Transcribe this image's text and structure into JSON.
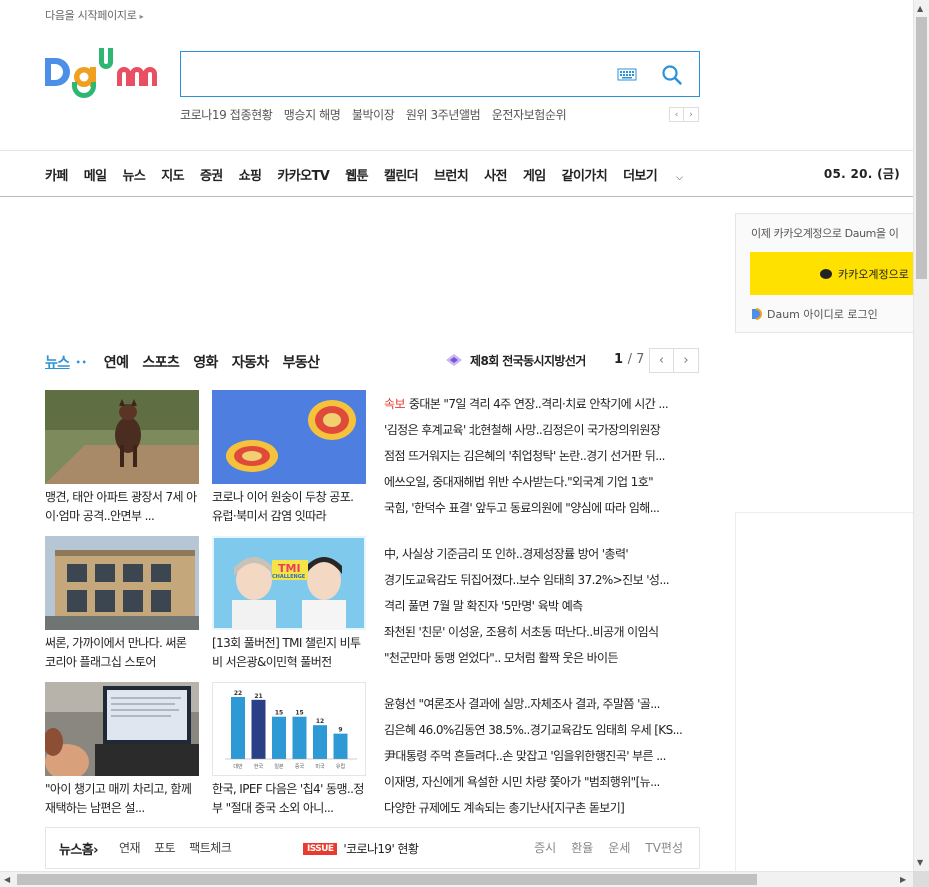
{
  "top_link": {
    "label": "다음을 시작페이지로",
    "arrow": "▸"
  },
  "logo": {
    "text": "Daum",
    "colors": [
      "#4b8fe9",
      "#f0a020",
      "#2eb673",
      "#e84f63"
    ]
  },
  "search": {
    "value": "",
    "keyboard_icon": "keyboard-icon",
    "search_icon": "search-icon",
    "accent": "#2b91d9"
  },
  "trends": {
    "items": [
      "코로나19 접종현황",
      "맹승지 해명",
      "불박이장",
      "원위 3주년앨범",
      "운전자보험순위"
    ],
    "prev": "‹",
    "next": "›"
  },
  "gnb": {
    "items": [
      "카페",
      "메일",
      "뉴스",
      "지도",
      "증권",
      "쇼핑",
      "카카오TV",
      "웹툰",
      "캘린더",
      "브런치",
      "사전",
      "게임",
      "같이가치",
      "더보기"
    ],
    "more_chevron": "⌵",
    "date": "05. 20. (금)"
  },
  "login": {
    "message": "이제 카카오계정으로 Daum을 이",
    "kakao_button": "카카오계정으로",
    "daum_login": "Daum 아이디로 로그인"
  },
  "news_tabs": {
    "items": [
      "뉴스",
      "연예",
      "스포츠",
      "영화",
      "자동차",
      "부동산"
    ],
    "active_dots": "••",
    "election": "제8회 전국동시지방선거",
    "page_current": "1",
    "page_total": "/ 7",
    "prev": "‹",
    "next": "›"
  },
  "cards": [
    {
      "caption": "맹견, 태안 아파트 광장서 7세 아이·엄마 공격..안면부 ..."
    },
    {
      "caption": "코로나 이어 원숭이 두창 공포. 유럽·북미서 감염 잇따라"
    },
    {
      "caption": "써론, 가까이에서 만나다. 써론 코리아 플래그십 스토어"
    },
    {
      "caption": "[13회 풀버전] TMI 챌린지 비투비 서은광&이민혁 풀버전",
      "thumb_badge": "TMI",
      "thumb_sub": "CHALLENGE"
    },
    {
      "caption": "\"아이 챙기고 매끼 차리고, 함께 재택하는 남편은 설..."
    },
    {
      "caption": "한국, IPEF 다음은 '칩4' 동맹..정부 \"절대 중국 소외 아니..."
    }
  ],
  "mini_chart": {
    "values": [
      22,
      21,
      15,
      15,
      12,
      9
    ],
    "categories": [
      "대만",
      "한국",
      "일본",
      "중국",
      "미국",
      "유럽"
    ],
    "colors": [
      "#2d9ad6",
      "#2b3f86",
      "#2d9ad6",
      "#2d9ad6",
      "#2d9ad6",
      "#2d9ad6"
    ]
  },
  "headlines": {
    "breaking_label": "속보",
    "group1": [
      "중대본 \"7일 격리 4주 연장..격리·치료 안착기에 시간 ...",
      "'김정은 후계교육' 北현철해 사망..김정은이 국가장의위원장",
      "점점 뜨거워지는 김은혜의 '취업청탁' 논란..경기 선거판 뒤...",
      "에쓰오일, 중대재해법 위반 수사받는다.\"외국계 기업 1호\"",
      "국힘, '한덕수 표결' 앞두고 동료의원에 \"양심에 따라 임해..."
    ],
    "group2": [
      "中, 사실상 기준금리 또 인하..경제성장률 방어 '총력'",
      "경기도교육감도 뒤집어졌다..보수 임태희 37.2%>진보 '성...",
      "격리 풀면 7월 말 확진자 '5만명' 육박 예측",
      "좌천된 '친문' 이성윤, 조용히 서초동 떠난다..비공개 이임식",
      "\"천군만마 동맹 얻었다\".. 모처럼 활짝 웃은 바이든"
    ],
    "group3": [
      "윤형선 \"여론조사 결과에 실망..자체조사 결과, 주말쯤 '골...",
      "김은혜 46.0%김동연 38.5%..경기교육감도 임태희 우세 [KS...",
      "尹대통령 주먹 흔들려다..손 맞잡고 '임을위한행진곡' 부른 ...",
      "이재명, 자신에게 욕설한 시민 차량 쫓아가 \"범죄행위\"[뉴...",
      "다양한 규제에도 계속되는 총기난사[지구촌 돋보기]"
    ]
  },
  "news_footer": {
    "home": "뉴스홈",
    "home_arrow": "›",
    "links": [
      "연재",
      "포토",
      "팩트체크"
    ],
    "issue_badge": "ISSUE",
    "issue_text": "'코로나19' 현황",
    "right_links": [
      "증시",
      "환율",
      "운세",
      "TV편성"
    ]
  },
  "scrollbars": {
    "up": "▲",
    "down": "▼",
    "left": "◀",
    "right": "▶"
  }
}
